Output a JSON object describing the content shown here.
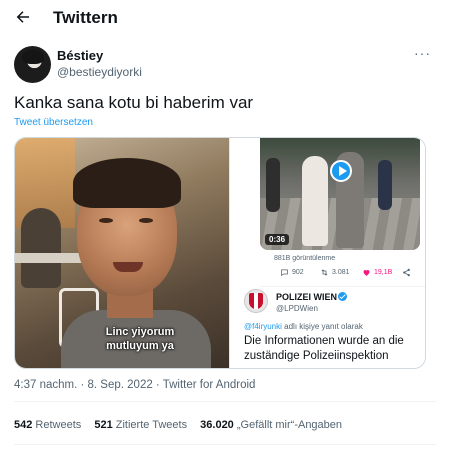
{
  "header": {
    "title": "Twittern"
  },
  "tweet": {
    "author_name": "Béstiey",
    "author_handle": "@bestieydiyorki",
    "text": "Kanka sana kotu bi haberim var",
    "translate": "Tweet übersetzen",
    "timestamp": "4:37 nachm. · 8. Sep. 2022 · Twitter for Android"
  },
  "media": {
    "caption_line1": "Linc yiyorum",
    "caption_line2": "mutluyum ya",
    "screenshot": {
      "duration": "0:36",
      "views": "881B görüntülenme",
      "replies": "902",
      "retweets": "3.081",
      "likes": "19,1B",
      "quoted_name": "POLIZEI WIEN",
      "quoted_handle": "@LPDWien",
      "reply_to_mention": "@f4iryunki",
      "reply_to_rest": " adlı kişiye yanıt olarak",
      "quoted_text": "Die Informationen wurde an die zuständige Polizeiinspektion"
    }
  },
  "counts": {
    "retweets_num": "542",
    "retweets_label": "Retweets",
    "quotes_num": "521",
    "quotes_label": "Zitierte Tweets",
    "likes_num": "36.020",
    "likes_label": "„Gefällt mir“-Angaben"
  },
  "colors": {
    "accent": "#1d9bf0",
    "like": "#f91880",
    "muted": "#536471"
  },
  "icons": [
    "back-arrow-icon",
    "more-icon",
    "play-icon",
    "reply-icon",
    "retweet-icon",
    "heart-icon",
    "share-icon",
    "verified-icon"
  ]
}
